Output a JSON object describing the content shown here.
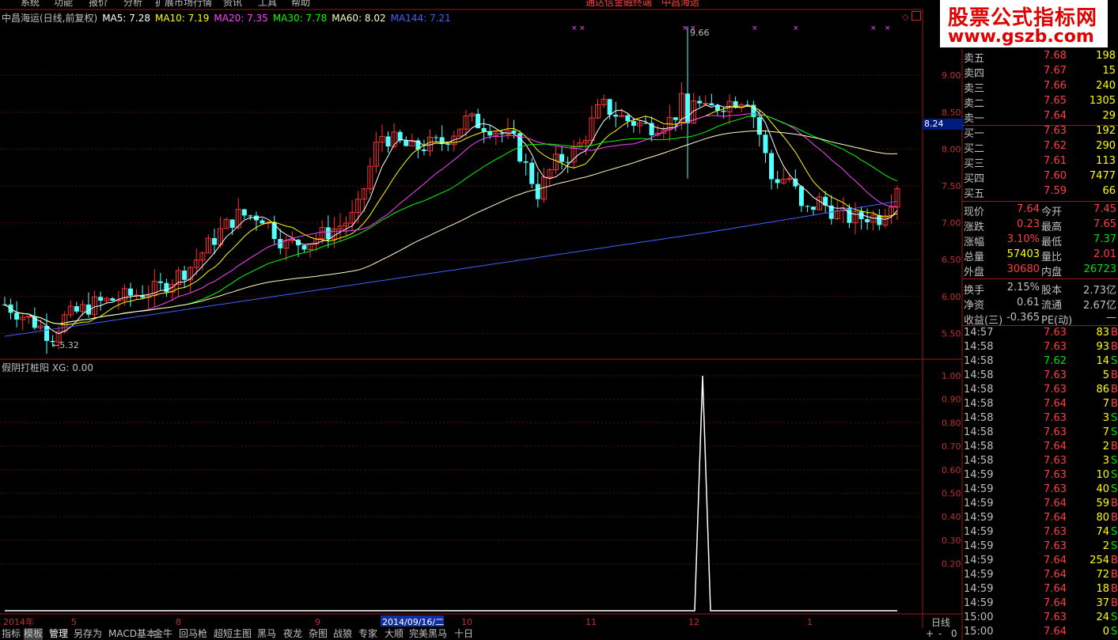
{
  "menu": [
    "系统",
    "功能",
    "报价",
    "分析",
    "扩展市场行情",
    "资讯",
    "工具",
    "帮助"
  ],
  "app_title": "通达信金融终端",
  "window_stock": "中昌海运",
  "watermark": {
    "line1": "股票公式指标网",
    "line2": "www.gszb.com"
  },
  "header": {
    "stock": "中昌海运(日线,前复权)",
    "ma5": "MA5: 7.28",
    "ma10": "MA10: 7.19",
    "ma20": "MA20: 7.35",
    "ma30": "MA30: 7.78",
    "ma60": "MA60: 8.02",
    "ma144": "MA144: 7.21"
  },
  "colors": {
    "up": "#ff3030",
    "down": "#54ffff",
    "ma5": "#ffffff",
    "ma10": "#ffff00",
    "ma20": "#ff40ff",
    "ma30": "#00ff00",
    "ma60": "#ffffc0",
    "ma144": "#4060ff"
  },
  "price_axis": {
    "labels": [
      "9.00",
      "8.50",
      "8.00",
      "7.50",
      "7.00",
      "6.50",
      "6.00",
      "5.50"
    ],
    "current": "8.24"
  },
  "annotations": {
    "high": "9.66",
    "low": "5.32"
  },
  "sub_header": "假阴打桩阳 XG: 0.00",
  "sub_axis": [
    "1.00",
    "0.90",
    "0.80",
    "0.70",
    "0.60",
    "0.50",
    "0.40",
    "0.30",
    "0.20"
  ],
  "date_axis": [
    "2014年",
    "5",
    "8",
    "9",
    "2014/09/16/二",
    "10",
    "11",
    "12",
    "1"
  ],
  "period_label": "日线",
  "order_book": [
    {
      "label": "卖五",
      "price": "7.68",
      "vol": "198"
    },
    {
      "label": "卖四",
      "price": "7.67",
      "vol": "15"
    },
    {
      "label": "卖三",
      "price": "7.66",
      "vol": "240"
    },
    {
      "label": "卖二",
      "price": "7.65",
      "vol": "1305"
    },
    {
      "label": "卖一",
      "price": "7.64",
      "vol": "29"
    },
    {
      "label": "买一",
      "price": "7.63",
      "vol": "192"
    },
    {
      "label": "买二",
      "price": "7.62",
      "vol": "290"
    },
    {
      "label": "买三",
      "price": "7.61",
      "vol": "113"
    },
    {
      "label": "买四",
      "price": "7.60",
      "vol": "7477"
    },
    {
      "label": "买五",
      "price": "7.59",
      "vol": "66"
    }
  ],
  "stats": [
    {
      "l1": "现价",
      "v1": "7.64",
      "c1": "#ff4040",
      "l2": "今开",
      "v2": "7.45",
      "c2": "#ff4040"
    },
    {
      "l1": "涨跌",
      "v1": "0.23",
      "c1": "#ff4040",
      "l2": "最高",
      "v2": "7.65",
      "c2": "#ff4040"
    },
    {
      "l1": "涨幅",
      "v1": "3.10%",
      "c1": "#ff4040",
      "l2": "最低",
      "v2": "7.37",
      "c2": "#00e000"
    },
    {
      "l1": "总量",
      "v1": "57403",
      "c1": "#ffff00",
      "l2": "量比",
      "v2": "2.01",
      "c2": "#ff4040"
    },
    {
      "l1": "外盘",
      "v1": "30680",
      "c1": "#ff4040",
      "l2": "内盘",
      "v2": "26723",
      "c2": "#00e000"
    },
    {
      "l1": "换手",
      "v1": "2.15%",
      "c1": "#c0c0c0",
      "l2": "股本",
      "v2": "2.73亿",
      "c2": "#c0c0c0"
    },
    {
      "l1": "净资",
      "v1": "0.61",
      "c1": "#c0c0c0",
      "l2": "流通",
      "v2": "2.67亿",
      "c2": "#c0c0c0"
    },
    {
      "l1": "收益(三)",
      "v1": "-0.365",
      "c1": "#c0c0c0",
      "l2": "PE(动)",
      "v2": "—",
      "c2": "#c0c0c0"
    }
  ],
  "ticks": [
    {
      "t": "14:57",
      "p": "7.63",
      "v": "83",
      "bs": "B"
    },
    {
      "t": "14:58",
      "p": "7.63",
      "v": "93",
      "bs": "B"
    },
    {
      "t": "14:58",
      "p": "7.62",
      "v": "14",
      "bs": "S"
    },
    {
      "t": "14:58",
      "p": "7.63",
      "v": "5",
      "bs": "B"
    },
    {
      "t": "14:58",
      "p": "7.63",
      "v": "86",
      "bs": "B"
    },
    {
      "t": "14:58",
      "p": "7.64",
      "v": "7",
      "bs": "B"
    },
    {
      "t": "14:58",
      "p": "7.63",
      "v": "3",
      "bs": "S"
    },
    {
      "t": "14:58",
      "p": "7.63",
      "v": "7",
      "bs": "S"
    },
    {
      "t": "14:58",
      "p": "7.64",
      "v": "2",
      "bs": "B"
    },
    {
      "t": "14:58",
      "p": "7.63",
      "v": "3",
      "bs": "S"
    },
    {
      "t": "14:59",
      "p": "7.63",
      "v": "10",
      "bs": "S"
    },
    {
      "t": "14:59",
      "p": "7.63",
      "v": "40",
      "bs": "S"
    },
    {
      "t": "14:59",
      "p": "7.64",
      "v": "59",
      "bs": "B"
    },
    {
      "t": "14:59",
      "p": "7.64",
      "v": "80",
      "bs": "B"
    },
    {
      "t": "14:59",
      "p": "7.63",
      "v": "74",
      "bs": "S"
    },
    {
      "t": "14:59",
      "p": "7.63",
      "v": "2",
      "bs": "S"
    },
    {
      "t": "14:59",
      "p": "7.64",
      "v": "254",
      "bs": "B"
    },
    {
      "t": "14:59",
      "p": "7.64",
      "v": "72",
      "bs": "B"
    },
    {
      "t": "14:59",
      "p": "7.64",
      "v": "18",
      "bs": "B"
    },
    {
      "t": "14:59",
      "p": "7.64",
      "v": "37",
      "bs": "B"
    },
    {
      "t": "15:00",
      "p": "7.63",
      "v": "24",
      "bs": "S"
    },
    {
      "t": "15:00",
      "p": "7.64",
      "v": "0",
      "bs": "S"
    }
  ],
  "bottom_tabs": [
    "指标",
    "模板",
    "管理",
    "另存为",
    "MACD基本",
    "金牛",
    "回马枪",
    "超短主图",
    "黑马",
    "夜龙",
    "杂图",
    "战狼",
    "专家",
    "大顺",
    "完美黑马",
    "十日"
  ],
  "zoom_buttons": [
    "+",
    "-",
    "0"
  ],
  "chart_data": {
    "type": "candlestick",
    "ylim": [
      5.3,
      9.7
    ],
    "series_points": 150
  }
}
